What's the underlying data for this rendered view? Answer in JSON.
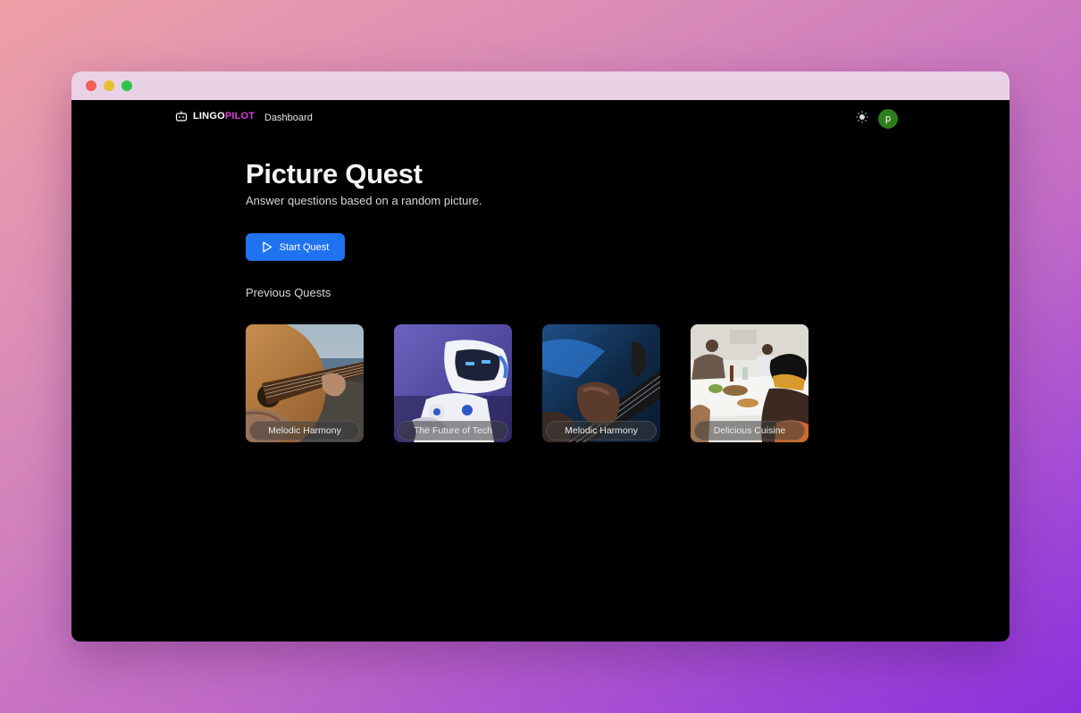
{
  "app": {
    "brand_part1": "LINGO",
    "brand_part2": "PILOT",
    "brand_icon": "robot-icon",
    "nav_link": "Dashboard",
    "theme_icon": "sun-icon",
    "avatar_initial": "p"
  },
  "main": {
    "title": "Picture Quest",
    "subtitle": "Answer questions based on a random picture.",
    "start_button": "Start Quest",
    "start_icon": "play-icon",
    "section_title": "Previous Quests"
  },
  "quests": [
    {
      "label": "Melodic Harmony"
    },
    {
      "label": "The Future of Tech"
    },
    {
      "label": "Melodic Harmony"
    },
    {
      "label": "Delicious Cuisine"
    }
  ],
  "colors": {
    "accent": "#1f73f1",
    "brand_highlight": "#e13ad8",
    "avatar": "#2e7d1d"
  }
}
